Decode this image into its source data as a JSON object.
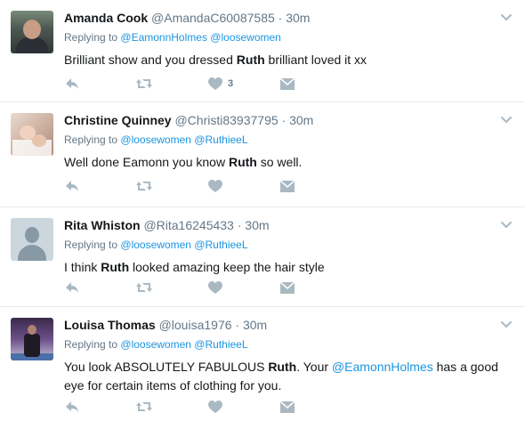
{
  "tweets": [
    {
      "name": "Amanda Cook",
      "handle": "@AmandaC60087585",
      "sep": "·",
      "time": "30m",
      "replying_prefix": "Replying to",
      "replying_to": [
        "@EamonnHolmes",
        "@loosewomen"
      ],
      "text_parts": [
        "Brilliant show and you dressed ",
        "Ruth",
        " brilliant loved it xx"
      ],
      "like_count": "3"
    },
    {
      "name": "Christine Quinney",
      "handle": "@Christi83937795",
      "sep": "·",
      "time": "30m",
      "replying_prefix": "Replying to",
      "replying_to": [
        "@loosewomen",
        "@RuthieeL"
      ],
      "text_parts": [
        "Well done Eamonn you know ",
        "Ruth",
        " so well."
      ],
      "like_count": ""
    },
    {
      "name": "Rita Whiston",
      "handle": "@Rita16245433",
      "sep": "·",
      "time": "30m",
      "replying_prefix": "Replying to",
      "replying_to": [
        "@loosewomen",
        "@RuthieeL"
      ],
      "text_parts": [
        "I think ",
        "Ruth",
        " looked amazing keep the hair style"
      ],
      "like_count": ""
    },
    {
      "name": "Louisa Thomas",
      "handle": "@louisa1976",
      "sep": "·",
      "time": "30m",
      "replying_prefix": "Replying to",
      "replying_to": [
        "@loosewomen",
        "@RuthieeL"
      ],
      "text_parts": [
        "You look ABSOLUTELY FABULOUS ",
        "Ruth",
        ". Your ",
        "@EamonnHolmes",
        " has a good eye for certain items of clothing for you."
      ],
      "like_count": ""
    }
  ],
  "icons": {
    "reply": "reply-icon",
    "retweet": "retweet-icon",
    "like": "heart-icon",
    "dm": "envelope-icon",
    "menu": "chevron-down-icon"
  },
  "colors": {
    "link": "#1b95e0",
    "muted": "#657786",
    "icon": "#aab8c2",
    "border": "#e6ecf0"
  }
}
